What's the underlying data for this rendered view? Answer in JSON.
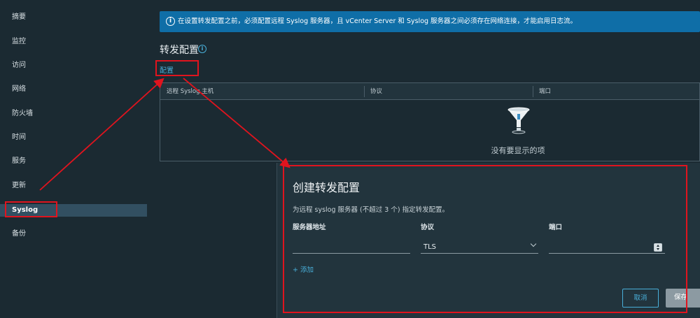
{
  "sidebar": {
    "items": [
      {
        "label": "摘要"
      },
      {
        "label": "监控"
      },
      {
        "label": "访问"
      },
      {
        "label": "网络"
      },
      {
        "label": "防火墙"
      },
      {
        "label": "时间"
      },
      {
        "label": "服务"
      },
      {
        "label": "更新"
      },
      {
        "label": "Syslog",
        "active": true
      },
      {
        "label": "备份"
      }
    ]
  },
  "banner": {
    "icon": "info-icon",
    "text": "在设置转发配置之前，必须配置远程 Syslog 服务器，且 vCenter Server 和 Syslog 服务器之间必须存在网络连接，才能启用日志流。"
  },
  "section": {
    "title": "转发配置",
    "info_icon": "i",
    "config_link": "配置"
  },
  "grid": {
    "columns": [
      "远程 Syslog 主机",
      "协议",
      "端口"
    ],
    "empty_icon": "filter-funnel-icon",
    "empty_text": "没有要显示的项"
  },
  "dialog": {
    "title": "创建转发配置",
    "description": "为远程 syslog 服务器 (不超过 3 个) 指定转发配置。",
    "labels": {
      "server": "服务器地址",
      "protocol": "协议",
      "port": "端口"
    },
    "server_value": "",
    "protocol_value": "TLS",
    "port_value": "",
    "add_label": "+ 添加",
    "cancel_label": "取消",
    "save_label": "保存"
  },
  "colors": {
    "background": "#1b2a32",
    "accent": "#49afd9",
    "banner": "#0f6ea7",
    "highlight": "#e0141e"
  }
}
